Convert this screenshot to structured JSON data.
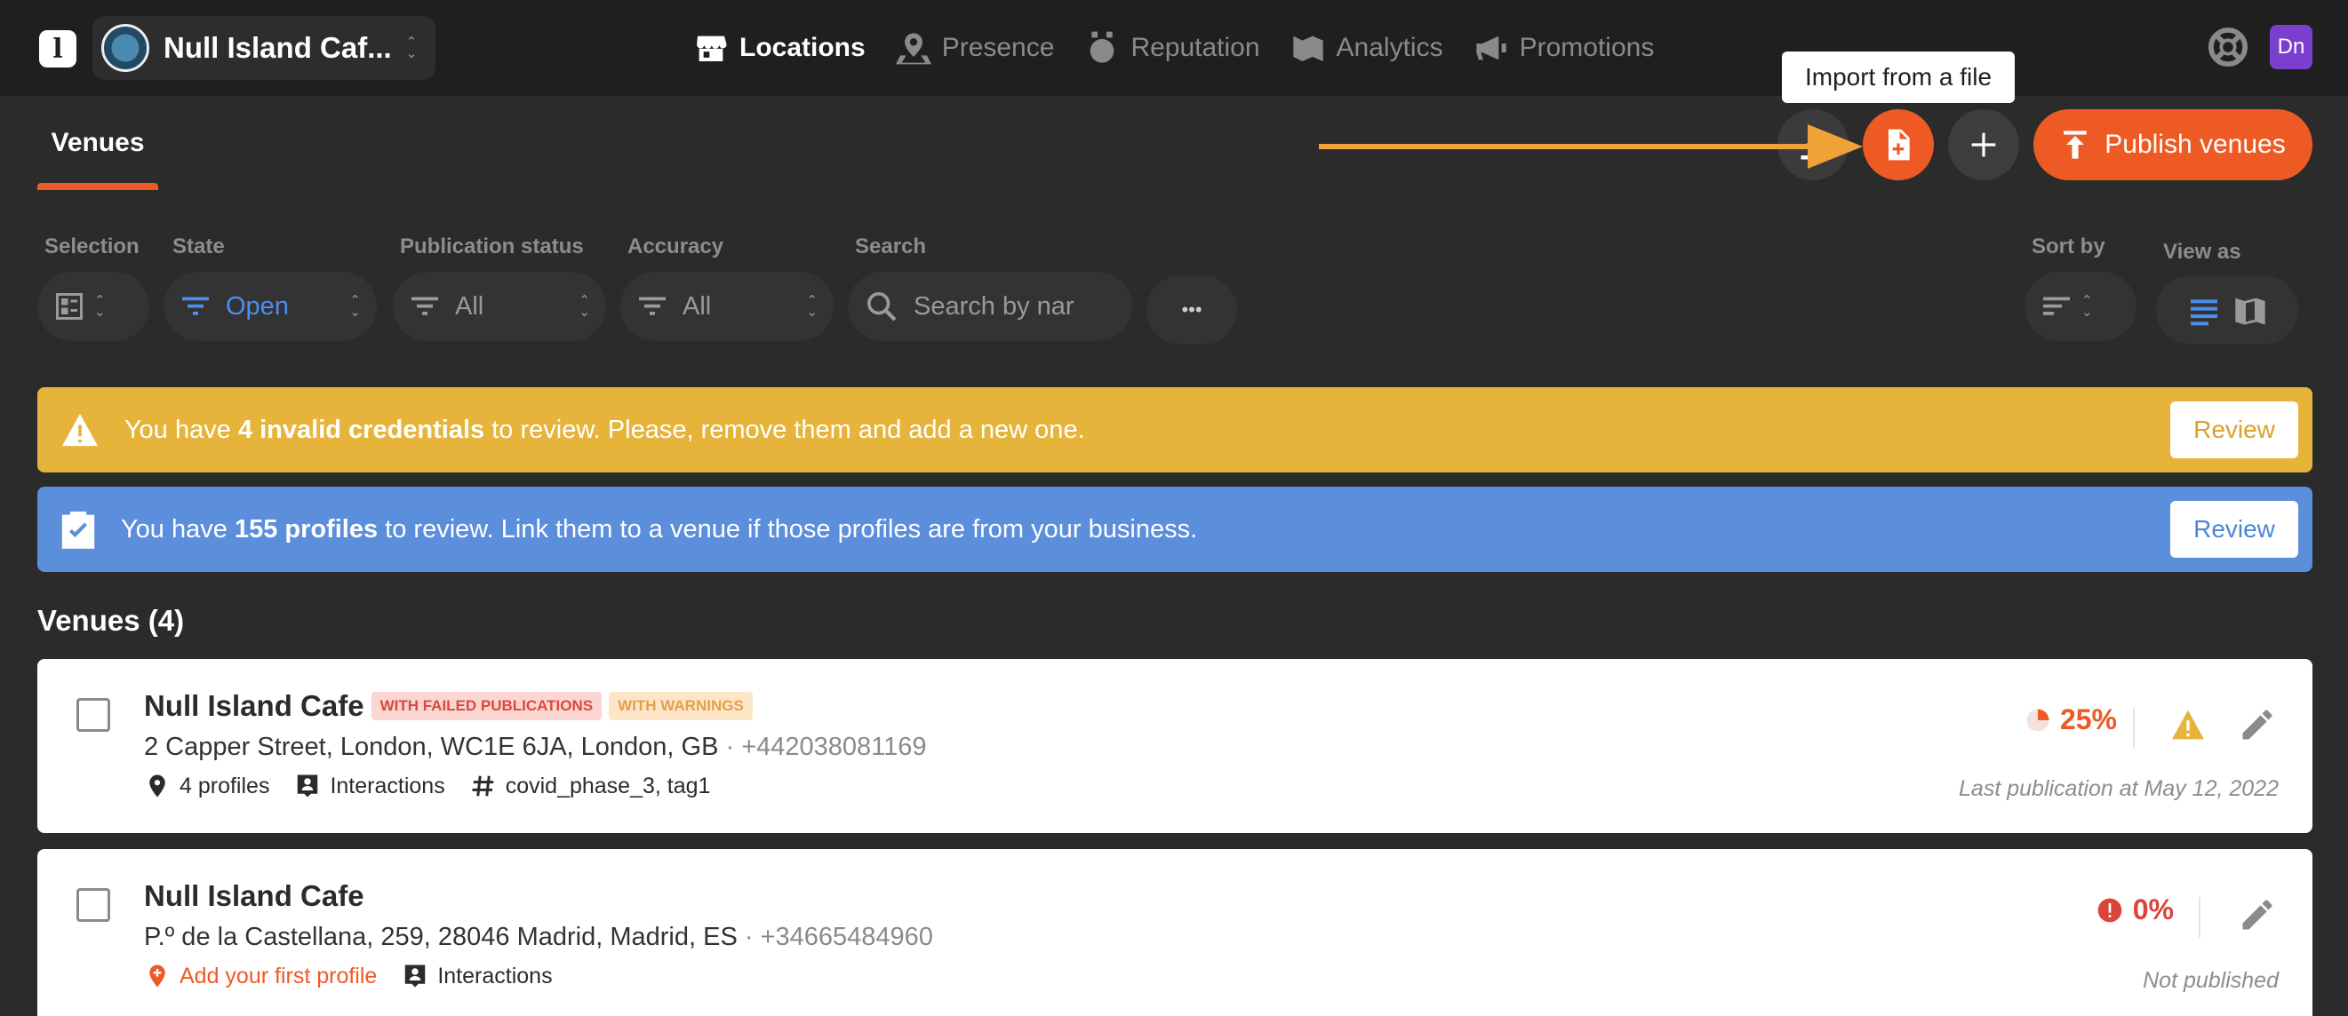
{
  "topbar": {
    "logo": "l",
    "business_name": "Null Island Caf...",
    "avatar_initials": "Dn",
    "nav": [
      {
        "label": "Locations",
        "icon": "store-icon",
        "active": true
      },
      {
        "label": "Presence",
        "icon": "location-pin-icon",
        "active": false
      },
      {
        "label": "Reputation",
        "icon": "award-icon",
        "active": false
      },
      {
        "label": "Analytics",
        "icon": "analytics-icon",
        "active": false
      },
      {
        "label": "Promotions",
        "icon": "megaphone-icon",
        "active": false
      }
    ]
  },
  "subheader": {
    "tab": "Venues",
    "tooltip": "Import from a file",
    "publish_label": "Publish venues",
    "add_label": "+"
  },
  "filters": {
    "selection_label": "Selection",
    "state_label": "State",
    "state_value": "Open",
    "publication_label": "Publication status",
    "publication_value": "All",
    "accuracy_label": "Accuracy",
    "accuracy_value": "All",
    "search_label": "Search",
    "search_placeholder": "Search by nar",
    "more_label": "•••",
    "sort_label": "Sort by",
    "view_label": "View as"
  },
  "banners": {
    "credentials": {
      "pre": "You have ",
      "bold": "4 invalid credentials",
      "post": " to review. Please, remove them and add a new one.",
      "button": "Review"
    },
    "profiles": {
      "pre": "You have ",
      "bold": "155 profiles",
      "post": " to review. Link them to a venue if those profiles are from your business.",
      "button": "Review"
    }
  },
  "venues_heading": "Venues (4)",
  "venues": [
    {
      "name": "Null Island Cafe",
      "tags": [
        "WITH FAILED PUBLICATIONS",
        "WITH WARNINGS"
      ],
      "address": "2 Capper Street, London, WC1E 6JA, London, GB",
      "phone": " · +442038081169",
      "profiles": "4 profiles",
      "interactions": "Interactions",
      "hashtags": "covid_phase_3, tag1",
      "percent": "25%",
      "last_publication": "Last publication at May 12, 2022"
    },
    {
      "name": "Null Island Cafe",
      "address": "P.º de la Castellana, 259, 28046 Madrid, Madrid, ES",
      "phone": " · +34665484960",
      "add_profile": "Add your first profile",
      "interactions": "Interactions",
      "percent": "0%",
      "last_publication": "Not published"
    }
  ],
  "colors": {
    "accent": "#ee5a24",
    "warning_banner": "#e6b43a",
    "info_banner": "#5b8edb",
    "link_blue": "#4b8ff0",
    "avatar_purple": "#7b3fd0"
  }
}
